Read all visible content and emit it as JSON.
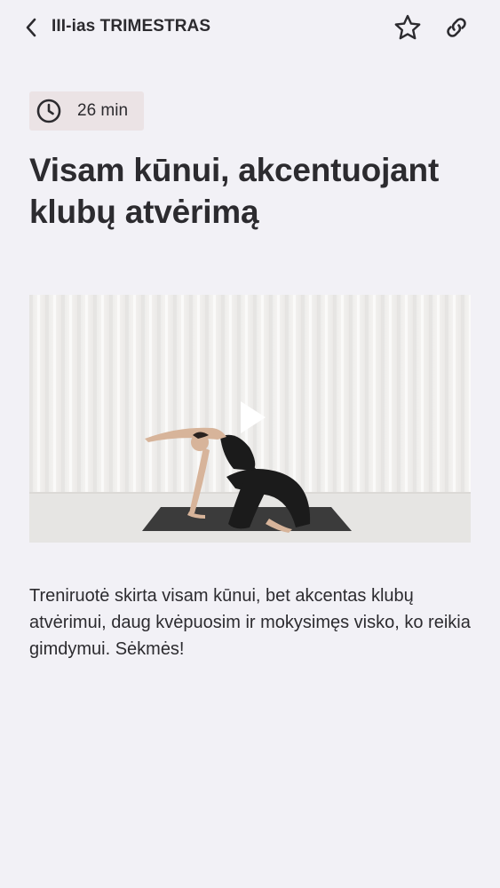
{
  "header": {
    "title": "III-ias TRIMESTRAS",
    "back_icon": "chevron-left-icon",
    "favorite_icon": "star-outline-icon",
    "share_icon": "link-icon"
  },
  "workout": {
    "duration": "26 min",
    "duration_icon": "clock-icon",
    "title": "Visam kūnui, akcentuojant klubų atvėrimą",
    "description": "Treniruotė skirta visam kūnui, bet akcentas klubų atvėrimui, daug kvėpuosim ir mokysimęs visko, ko reikia gimdymui. Sėkmės!",
    "video_play_icon": "play-icon"
  },
  "colors": {
    "background": "#f2f1f6",
    "badge_background": "#ebe3e5",
    "text": "#2c2b2f"
  }
}
